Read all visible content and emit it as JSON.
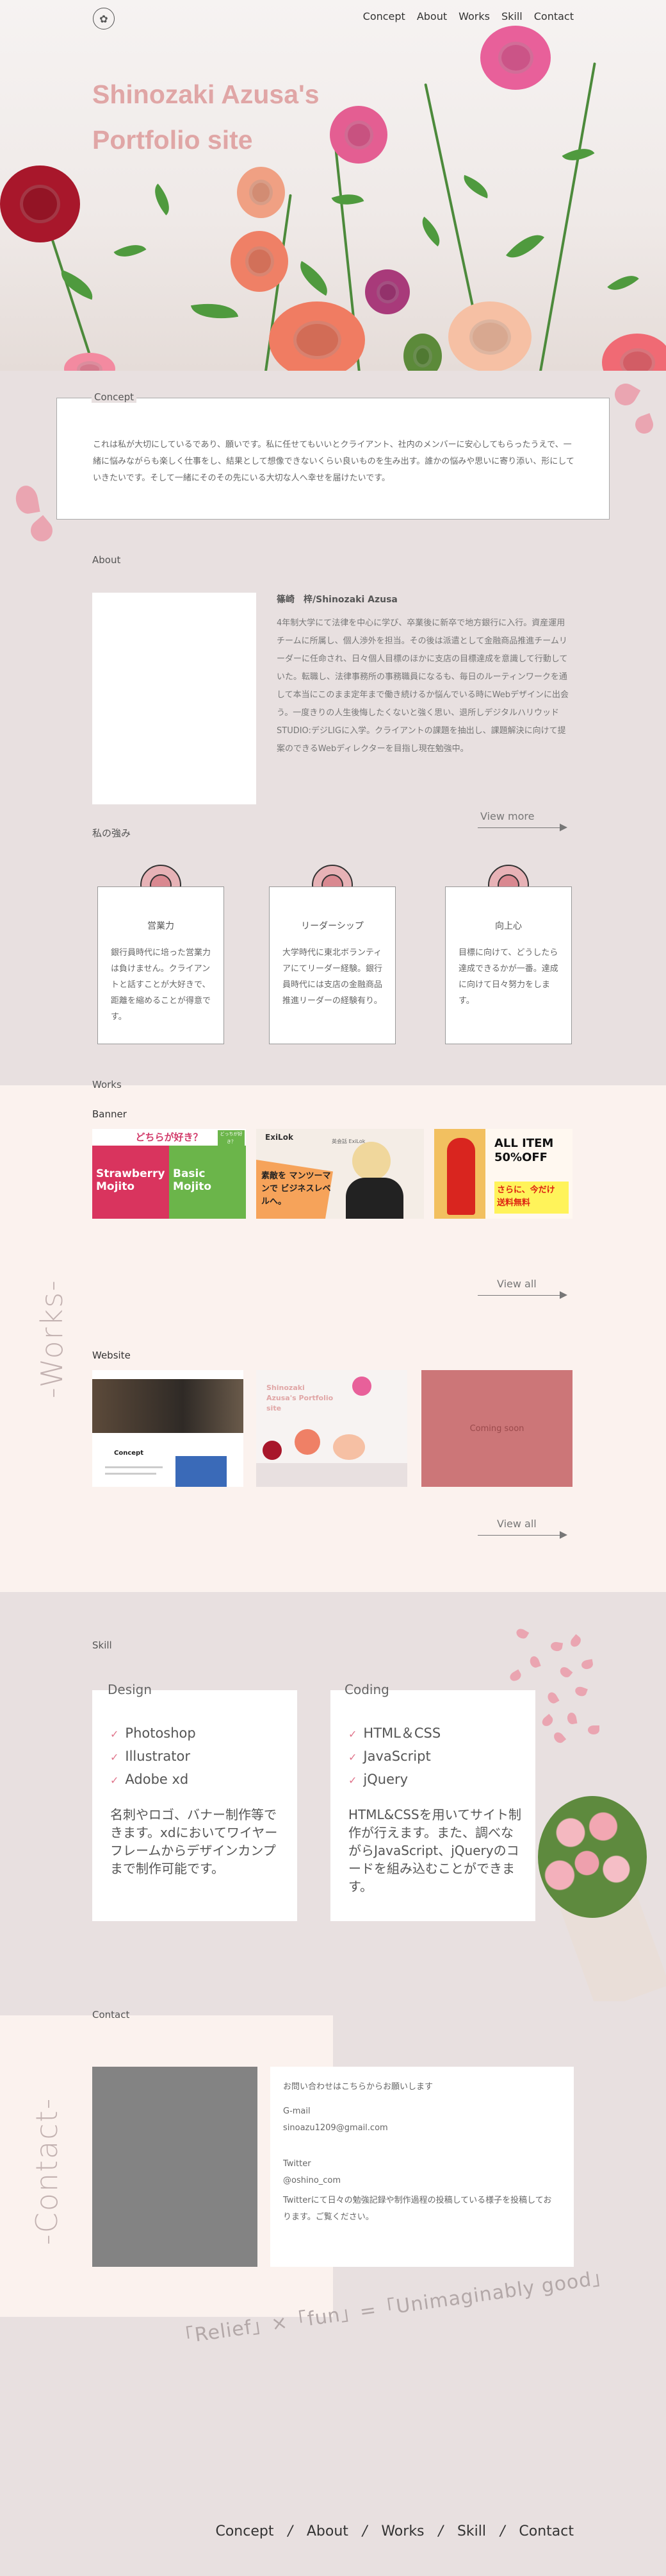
{
  "nav": {
    "logo_glyph": "✿",
    "items": [
      "Concept",
      "About",
      "Works",
      "Skill",
      "Contact"
    ]
  },
  "hero": {
    "title_line1": "Shinozaki Azusa's",
    "title_line2": "Portfolio site"
  },
  "concept": {
    "label": "Concept",
    "text": "これは私が大切にしているであり、願いです。私に任せてもいいとクライアント、社内のメンバーに安心してもらったうえで、一緒に悩みながらも楽しく仕事をし、結果として想像できないくらい良いものを生み出す。誰かの悩みや思いに寄り添い、形にしていきたいです。そして一緒にそのその先にいる大切な人へ幸せを届けたいです。"
  },
  "about": {
    "label": "About",
    "name": "篠崎　梓/Shinozaki Azusa",
    "text": "4年制大学にて法律を中心に学び、卒業後に新卒で地方銀行に入行。資産運用チームに所属し、個人渉外を担当。その後は派遣として金融商品推進チームリーダーに任命され、日々個人目標のほかに支店の目標達成を意識して行動していた。転職し、法律事務所の事務職員になるも、毎日のルーティンワークを通して本当にこのまま定年まで働き続けるか悩んでいる時にWebデザインに出会う。一度きりの人生後悔したくないと強く思い、退所しデジタルハリウッドSTUDIO:デジLIGに入学。クライアントの課題を抽出し、課題解決に向けて提案のできるWebディレクターを目指し現在勉強中。",
    "more": "View more"
  },
  "strengths": {
    "label": "私の強み",
    "cards": [
      {
        "title": "営業力",
        "text": "銀行員時代に培った営業力は負けません。クライアントと話すことが大好きで、距離を縮めることが得意です。"
      },
      {
        "title": "リーダーシップ",
        "text": "大学時代に東北ボランティアにてリーダー経験。銀行員時代には支店の金融商品推進リーダーの経験有り。"
      },
      {
        "title": "向上心",
        "text": "目標に向けて、どうしたら達成できるかが一番。達成に向けて日々努力をします。"
      }
    ]
  },
  "works": {
    "label": "Works",
    "vertical": "-Works-",
    "banner_label": "Banner",
    "website_label": "Website",
    "view_all": "View all",
    "banner1": {
      "top": "どちらが好き？",
      "left": "Strawberry Mojito",
      "right": "Basic Mojito",
      "badge": "どっちが好き？"
    },
    "banner2": {
      "logo": "ExiLok",
      "text": "素敵を マンツーマンで ビジネスレベルへ。",
      "sub": "英会話 ExiLok"
    },
    "banner3": {
      "big": "ALL ITEM 50%OFF",
      "sub": "さらに、今だけ 送料無料"
    },
    "site2": {
      "title": "Shinozaki Azusa's Portfolio site"
    },
    "site3": {
      "text": "Coming soon"
    }
  },
  "skill": {
    "label": "Skill",
    "design": {
      "head": "Design",
      "items": [
        "Photoshop",
        "Illustrator",
        "Adobe xd"
      ],
      "desc": "名刺やロゴ、バナー制作等できます。xdにおいてワイヤーフレームからデザインカンプまで制作可能です。"
    },
    "coding": {
      "head": "Coding",
      "items": [
        "HTML＆CSS",
        "JavaScript",
        "jQuery"
      ],
      "desc": "HTML&CSSを用いてサイト制作が行えます。また、調べながらJavaScript、jQueryのコードを組み込むことができます。"
    }
  },
  "contact": {
    "label": "Contact",
    "vertical": "-Contact-",
    "intro": "お問い合わせはこちらからお願いします",
    "gmail_label": "G-mail",
    "gmail": "sinoazu1209@gmail.com",
    "twitter_label": "Twitter",
    "twitter": "@oshino_com",
    "twitter_desc": "Twitterにて日々の勉強記録や制作過程の投稿している様子を投稿しております。ご覧ください。"
  },
  "slogan": "「Relief」×「fun」=「Unimaginably good」",
  "footer": {
    "items": [
      "Concept",
      "About",
      "Works",
      "Skill",
      "Contact"
    ],
    "sep": "/"
  }
}
